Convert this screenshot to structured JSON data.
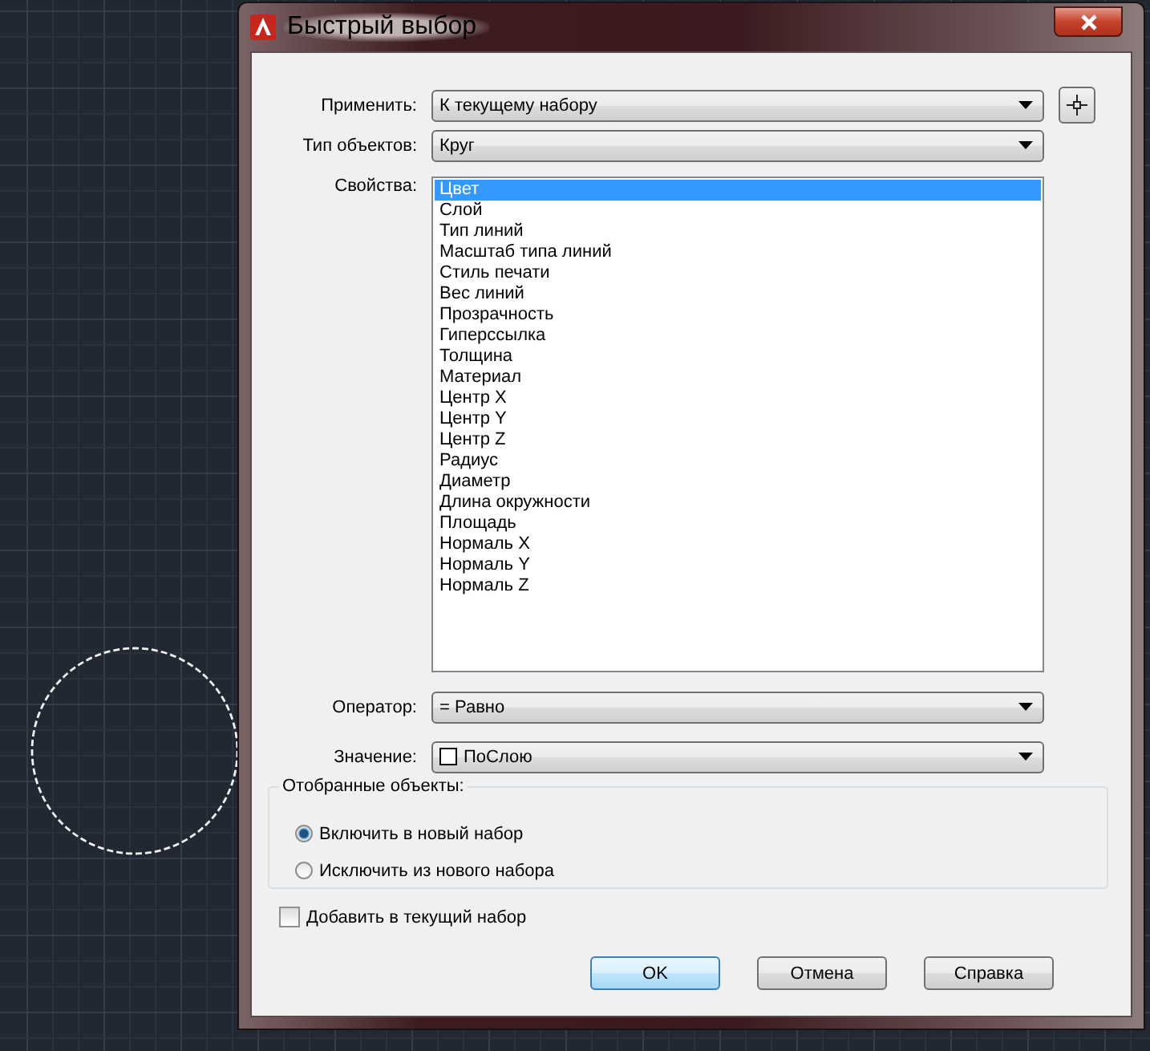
{
  "window": {
    "title": "Быстрый выбор"
  },
  "fields": [
    {
      "kind": "combo-pick",
      "label": "Применить:",
      "value": "К текущему набору"
    },
    {
      "kind": "combo",
      "label": "Тип объектов:",
      "value": "Круг"
    }
  ],
  "properties": {
    "label": "Свойства:",
    "items": [
      {
        "text": "Цвет",
        "selected": true
      },
      {
        "text": "Слой",
        "selected": false
      },
      {
        "text": "Тип линий",
        "selected": false
      },
      {
        "text": "Масштаб типа линий",
        "selected": false
      },
      {
        "text": "Стиль печати",
        "selected": false
      },
      {
        "text": "Вес линий",
        "selected": false
      },
      {
        "text": "Прозрачность",
        "selected": false
      },
      {
        "text": "Гиперссылка",
        "selected": false
      },
      {
        "text": "Толщина",
        "selected": false
      },
      {
        "text": "Материал",
        "selected": false
      },
      {
        "text": "Центр X",
        "selected": false
      },
      {
        "text": "Центр Y",
        "selected": false
      },
      {
        "text": "Центр Z",
        "selected": false
      },
      {
        "text": "Радиус",
        "selected": false
      },
      {
        "text": "Диаметр",
        "selected": false
      },
      {
        "text": "Длина окружности",
        "selected": false
      },
      {
        "text": "Площадь",
        "selected": false
      },
      {
        "text": "Нормаль X",
        "selected": false
      },
      {
        "text": "Нормаль Y",
        "selected": false
      },
      {
        "text": "Нормаль Z",
        "selected": false
      }
    ]
  },
  "fields2": [
    {
      "kind": "combo",
      "label": "Оператор:",
      "value": "= Равно"
    },
    {
      "kind": "color-combo",
      "label": "Значение:",
      "value": "ПоСлою"
    }
  ],
  "group": {
    "title": "Отобранные объекты:",
    "options": [
      {
        "label": "Включить в новый набор",
        "selected": true
      },
      {
        "label": "Исключить из нового набора",
        "selected": false
      }
    ]
  },
  "checkbox": {
    "label": "Добавить в текущий набор",
    "checked": false
  },
  "buttons": [
    {
      "label": "OK",
      "default": true
    },
    {
      "label": "Отмена",
      "default": false
    },
    {
      "label": "Справка",
      "default": false
    }
  ]
}
